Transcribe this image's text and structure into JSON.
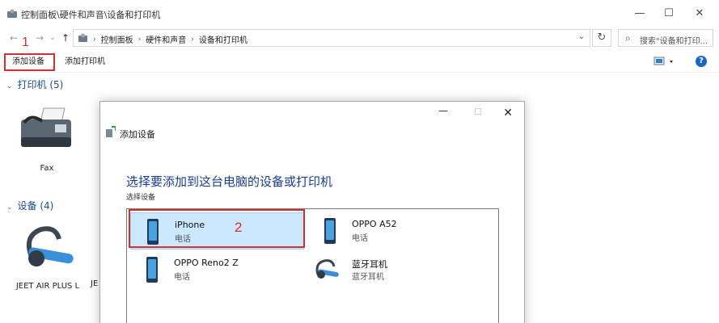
{
  "window": {
    "title": "控制面板\\硬件和声音\\设备和打印机",
    "minimize": "—",
    "maximize": "☐",
    "close": "✕"
  },
  "nav": {
    "back": "←",
    "forward": "→",
    "recent": "⌄",
    "up": "↑",
    "breadcrumbs": [
      "控制面板",
      "硬件和声音",
      "设备和打印机"
    ],
    "search_placeholder": "搜索\"设备和打印...",
    "refresh": "↻"
  },
  "toolbar": {
    "add_device": "添加设备",
    "add_printer": "添加打印机",
    "help": "?"
  },
  "annotations": {
    "step1": "1",
    "step2": "2"
  },
  "sections": {
    "printers": {
      "label": "打印机 (5)",
      "items": [
        {
          "label": "Fax"
        }
      ]
    },
    "devices": {
      "label": "设备 (4)",
      "items": [
        {
          "label": "JEET AIR PLUS L"
        },
        {
          "label": "JE"
        }
      ]
    }
  },
  "dialog": {
    "title": "添加设备",
    "heading": "选择要添加到这台电脑的设备或打印机",
    "subheading": "选择设备",
    "devices": [
      {
        "name": "iPhone",
        "type": "电话",
        "icon": "phone-icon"
      },
      {
        "name": "OPPO A52",
        "type": "电话",
        "icon": "phone-icon"
      },
      {
        "name": "OPPO Reno2 Z",
        "type": "电话",
        "icon": "phone-icon"
      },
      {
        "name": "蓝牙耳机",
        "type": "蓝牙耳机",
        "icon": "headset-icon"
      }
    ]
  },
  "colors": {
    "accent": "#1a67c3",
    "highlight": "#d32f2f",
    "selection": "#cce8ff",
    "section_text": "#1a4d8c"
  }
}
